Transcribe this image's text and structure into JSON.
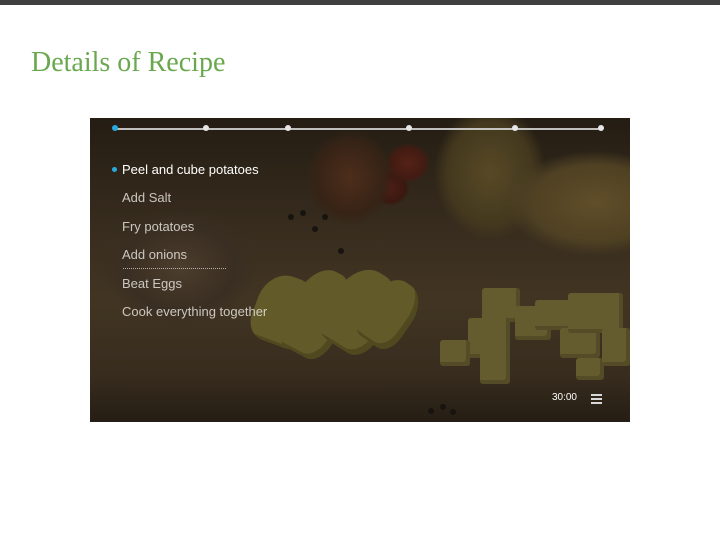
{
  "page": {
    "title": "Details of Recipe",
    "title_color": "#6aa84f",
    "top_bar_color": "#404040"
  },
  "recipe_player": {
    "timeline": {
      "total_steps": 6,
      "current_step": 1,
      "active_color": "#29a8e0"
    },
    "steps": [
      {
        "label": "Peel and cube potatoes",
        "active": true
      },
      {
        "label": "Add Salt",
        "active": false
      },
      {
        "label": "Fry potatoes",
        "active": false
      },
      {
        "label": "Add onions",
        "active": false
      },
      {
        "label": "Beat Eggs",
        "active": false
      },
      {
        "label": "Cook everything together",
        "active": false
      }
    ],
    "timer": "30:00",
    "menu_icon": "hamburger-menu-icon"
  }
}
